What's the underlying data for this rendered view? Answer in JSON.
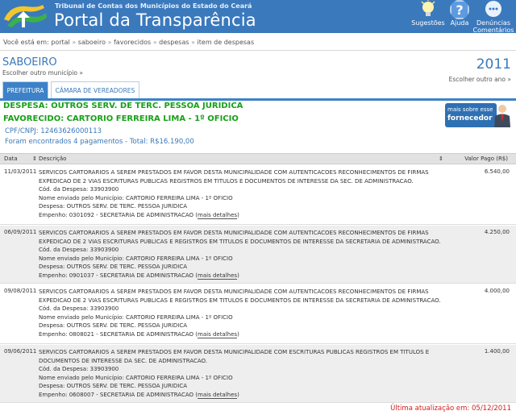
{
  "header": {
    "org": "Tribunal de Contas dos Municípios do Estado do Ceará",
    "title": "Portal da Transparência",
    "buttons": {
      "sugestoes": "Sugestões",
      "ajuda": "Ajuda",
      "denuncias": "Denúncias",
      "comentarios": "Comentários"
    }
  },
  "breadcrumb": {
    "prefix": "Você está em:",
    "items": [
      "portal",
      "saboeiro",
      "favorecidos",
      "despesas",
      "item de despesas"
    ],
    "separator": "»"
  },
  "municipio": {
    "name": "SABOEIRO",
    "change_link": "Escolher outro município »"
  },
  "ano": {
    "value": "2011",
    "change_link": "Escolher outro ano »"
  },
  "tabs": [
    "PREFEITURA",
    "CÂMARA DE VEREADORES"
  ],
  "despesa": {
    "title": "DESPESA: OUTROS SERV. DE TERC. PESSOA JURIDICA",
    "favorecido": "FAVORECIDO: CARTORIO FERREIRA LIMA - 1º OFICIO",
    "cpf": "CPF/CNPJ: 12463626000113",
    "found": "Foram encontrados 4 pagamentos - Total: R$16.190,00"
  },
  "fornecedor_button": {
    "line1": "mais sobre esse",
    "line2": "fornecedor"
  },
  "table": {
    "headers": {
      "date": "Data",
      "sort_icon": "⇕",
      "desc": "Descrição",
      "value": "Valor Pago (R$)"
    },
    "more_label": "mais detalhes",
    "rows": [
      {
        "date": "11/03/2011",
        "value": "6.540,00",
        "lines": [
          "SERVICOS CARTORARIOS A SEREM PRESTADOS EM FAVOR DESTA MUNICIPALIDADE COM AUTENTICACOES RECONHECIMENTOS DE FIRMAS",
          "EXPEDICAO DE 2 VIAS ESCRITURAS PUBLICAS REGISTROS EM TITULOS E DOCUMENTOS DE INTERESSE DA SEC. DE ADMINISTRACAO.",
          "Cód. da Despesa: 33903900",
          "Nome enviado pelo Município: CARTORIO FERREIRA LIMA - 1º OFICIO",
          "Despesa: OUTROS SERV. DE TERC. PESSOA JURIDICA"
        ],
        "empenho": "Empenho: 0301092 - SECRETARIA DE ADMINISTRACAO"
      },
      {
        "date": "06/09/2011",
        "value": "4.250,00",
        "lines": [
          "SERVICOS CARTORARIOS A SEREM PRESTADOS EM FAVOR DESTA MUNICIPALIDADE COM AUTENTICACOES RECONHECIMENTOS DE FIRMAS",
          "EXPEDICAO DE 2 VIAS ESCRITURAS PUBLICAS E REGISTROS EM TITULOS E DOCUMENTOS DE INTERESSE DA SECRETARIA DE ADMINISTRACAO.",
          "Cód. da Despesa: 33903900",
          "Nome enviado pelo Município: CARTORIO FERREIRA LIMA - 1º OFICIO",
          "Despesa: OUTROS SERV. DE TERC. PESSOA JURIDICA"
        ],
        "empenho": "Empenho: 0901037 - SECRETARIA DE ADMINISTRACAO"
      },
      {
        "date": "09/08/2011",
        "value": "4.000,00",
        "lines": [
          "SERVICOS CARTORARIOS A SEREM PRESTADOS EM FAVOR DESTA MUNICIPALIDADE COM AUTENTICACOES RECONHECIMENTOS DE FIRMAS",
          "EXPEDICAO DE 2 VIAS ESCRITURAS PUBLICAS E REGISTROS EM TITULOS E DOCUMENTOS DE INTERESSE DA SECRETARIA DE ADMINISTRACAO.",
          "Cód. da Despesa: 33903900",
          "Nome enviado pelo Município: CARTORIO FERREIRA LIMA - 1º OFICIO",
          "Despesa: OUTROS SERV. DE TERC. PESSOA JURIDICA"
        ],
        "empenho": "Empenho: 0808021 - SECRETARIA DE ADMINISTRACAO"
      },
      {
        "date": "09/06/2011",
        "value": "1.400,00",
        "lines": [
          "SERVICOS CARTORARIOS A SEREM PRESTADOS EM FAVOR DESTA MUNICIPALIDADE COM ESCRITURAS PUBLICAS REGISTROS EM TITULOS E",
          "DOCUMENTOS DE INTERESSE DA SEC. DE ADMINISTRACAO.",
          "Cód. da Despesa: 33903900",
          "Nome enviado pelo Município: CARTORIO FERREIRA LIMA - 1º OFICIO",
          "Despesa: OUTROS SERV. DE TERC. PESSOA JURIDICA"
        ],
        "empenho": "Empenho: 0608007 - SECRETARIA DE ADMINISTRACAO"
      }
    ]
  },
  "footer": {
    "updated": "Última atualização em: 05/12/2011"
  }
}
